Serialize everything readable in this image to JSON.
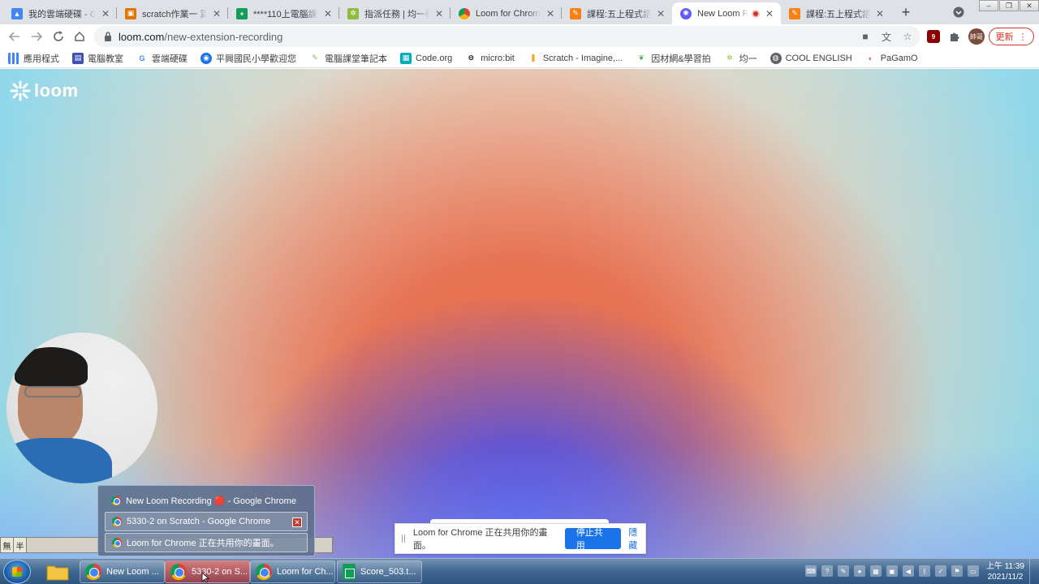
{
  "tabs": [
    {
      "title": "我的雲端硬碟 - Go",
      "icon": "google-drive-icon",
      "color": "#4285f4"
    },
    {
      "title": "scratch作業一 篇",
      "icon": "classroom-icon",
      "color": "#e37400"
    },
    {
      "title": "****110上電腦課",
      "icon": "sheets-icon",
      "color": "#0f9d58"
    },
    {
      "title": "指派任務 | 均一教",
      "icon": "junyi-icon",
      "color": "#8fbc3f"
    },
    {
      "title": "Loom for Chrome",
      "icon": "chrome-webstore-icon",
      "color": "#db4437"
    },
    {
      "title": "課程:五上程式語言",
      "icon": "moodle-icon",
      "color": "#f98012"
    },
    {
      "title": "New Loom Re",
      "icon": "loom-icon",
      "color": "#625df5"
    },
    {
      "title": "課程:五上程式語言",
      "icon": "moodle-icon",
      "color": "#f98012"
    }
  ],
  "toolbar": {
    "url_host": "loom.com",
    "url_path": "/new-extension-recording",
    "update_label": "更新",
    "avatar_label": "帥哥",
    "extension_badge": "9"
  },
  "bookmarks": [
    {
      "label": "應用程式",
      "icon": "apps-grid-icon",
      "color": "#4285f4"
    },
    {
      "label": "電腦教室",
      "icon": "bookmark-classroom-icon",
      "color": "#3f51b5"
    },
    {
      "label": "雲端硬碟",
      "icon": "google-g-icon",
      "color": "#4285f4"
    },
    {
      "label": "平興國民小學歡迎您",
      "icon": "school-icon",
      "color": "#1a73e8"
    },
    {
      "label": "電腦課堂筆記本",
      "icon": "notebook-icon",
      "color": "#8bc34a"
    },
    {
      "label": "Code.org",
      "icon": "codeorg-icon",
      "color": "#00adbc"
    },
    {
      "label": "micro:bit",
      "icon": "microbit-icon",
      "color": "#000000"
    },
    {
      "label": "Scratch - Imagine,...",
      "icon": "scratch-icon",
      "color": "#f7a11b"
    },
    {
      "label": "因材網&學習拍",
      "icon": "leaf-icon",
      "color": "#4caf50"
    },
    {
      "label": "均一",
      "icon": "junyi-icon",
      "color": "#8fbc3f"
    },
    {
      "label": "COOL ENGLISH",
      "icon": "globe-icon",
      "color": "#5f6368"
    },
    {
      "label": "PaGamO",
      "icon": "pagamo-icon",
      "color": "#f44336"
    }
  ],
  "page": {
    "logo_text": "loom"
  },
  "ime": {
    "mode1": "無",
    "mode2": "半"
  },
  "thumb_popup": {
    "items": [
      "New Loom Recording 🔴 - Google Chrome",
      "5330-2 on Scratch - Google Chrome",
      "Loom for Chrome 正在共用你的畫面。"
    ]
  },
  "share_bar": {
    "message": "Loom for Chrome 正在共用你的畫面。",
    "stop_label": "停止共用",
    "hide_label": "隱藏"
  },
  "taskbar": {
    "tasks": [
      "New Loom ...",
      "5330-2 on S...",
      "Loom for Ch...",
      "Score_503.t..."
    ],
    "time": "上午 11:39",
    "date": "2021/11/2"
  }
}
